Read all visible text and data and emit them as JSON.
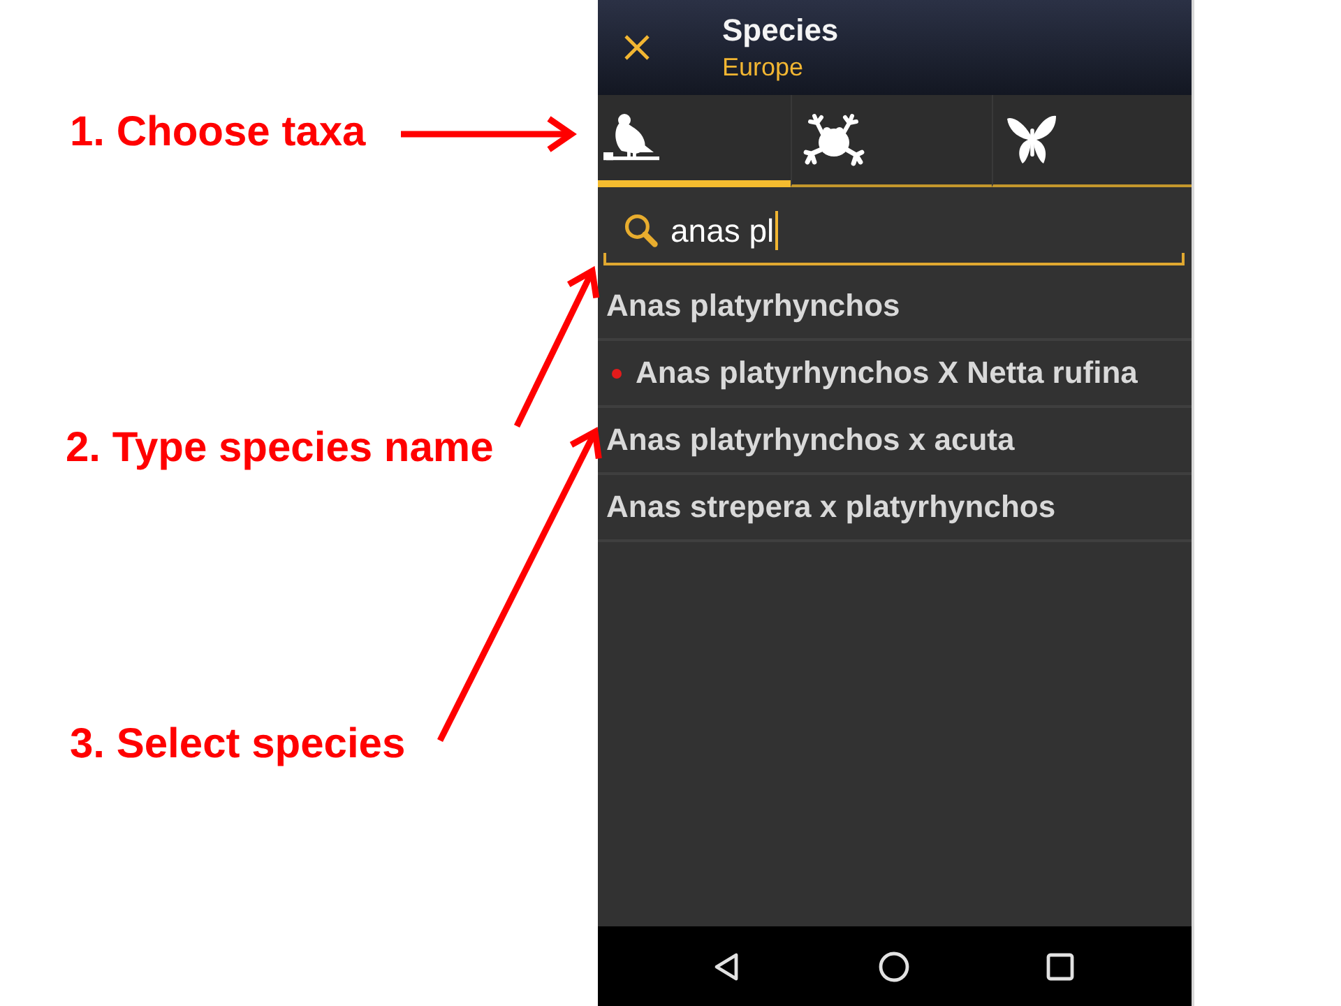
{
  "annotations": [
    {
      "label": "1. Choose taxa"
    },
    {
      "label": "2. Type species name"
    },
    {
      "label": "3. Select species"
    }
  ],
  "app_bar": {
    "title": "Species",
    "subtitle": "Europe"
  },
  "taxa_tabs": [
    {
      "kind": "bird",
      "selected": true
    },
    {
      "kind": "frog",
      "selected": false
    },
    {
      "kind": "butterfly",
      "selected": false
    }
  ],
  "search": {
    "value": "anas pl"
  },
  "results": [
    {
      "name": "Anas platyrhynchos",
      "flagged": false
    },
    {
      "name": "Anas platyrhynchos X Netta rufina",
      "flagged": true
    },
    {
      "name": "Anas platyrhynchos x acuta",
      "flagged": false
    },
    {
      "name": "Anas strepera x platyrhynchos",
      "flagged": false
    }
  ]
}
